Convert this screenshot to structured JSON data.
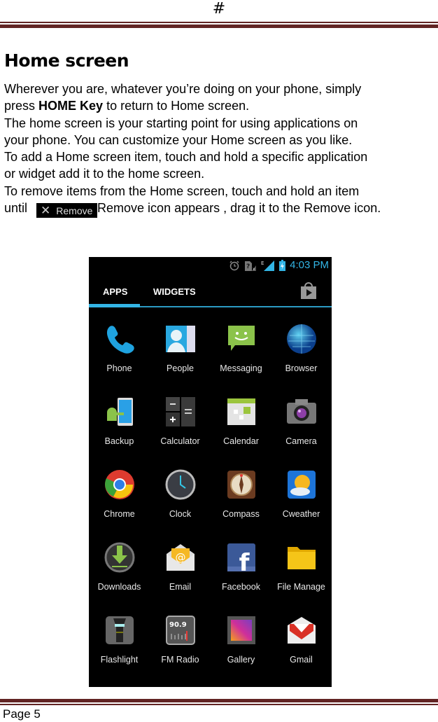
{
  "header": {
    "mark": "#"
  },
  "section": {
    "title": "Home screen",
    "paragraphs": [
      {
        "pre": "Wherever you are, whatever you’re doing on your phone, simply"
      },
      {
        "pre": "press ",
        "bold": "HOME Key",
        "post": " to return to Home screen."
      },
      {
        "pre": "The home screen is your starting point for using applications on"
      },
      {
        "pre": "your phone. You can customize your Home screen as you like."
      },
      {
        "pre": "To add a Home screen item, touch and hold a specific application"
      },
      {
        "pre": "or widget add it to the home screen."
      },
      {
        "pre": "To remove items from the Home screen, touch and hold an item"
      },
      {
        "pre": "until ",
        "chip": "Remove",
        "post": "Remove icon appears , drag it to the Remove icon."
      }
    ],
    "remove_chip": {
      "x": "✕",
      "label": "Remove"
    }
  },
  "phone": {
    "status": {
      "time": "4:03 PM",
      "icons": [
        "alarm-icon",
        "no-sim-icon",
        "signal-edge-icon",
        "battery-charging-icon"
      ],
      "edge_label": "E"
    },
    "tabs": [
      {
        "label": "APPS",
        "active": true
      },
      {
        "label": "WIDGETS",
        "active": false
      }
    ],
    "store_icon": "play-store-icon",
    "apps": [
      {
        "label": "Phone",
        "icon": "phone-icon"
      },
      {
        "label": "People",
        "icon": "people-icon"
      },
      {
        "label": "Messaging",
        "icon": "messaging-icon"
      },
      {
        "label": "Browser",
        "icon": "browser-icon"
      },
      {
        "label": "Backup",
        "icon": "backup-icon"
      },
      {
        "label": "Calculator",
        "icon": "calculator-icon"
      },
      {
        "label": "Calendar",
        "icon": "calendar-icon"
      },
      {
        "label": "Camera",
        "icon": "camera-icon"
      },
      {
        "label": "Chrome",
        "icon": "chrome-icon"
      },
      {
        "label": "Clock",
        "icon": "clock-icon"
      },
      {
        "label": "Compass",
        "icon": "compass-icon"
      },
      {
        "label": "Cweather",
        "icon": "weather-icon"
      },
      {
        "label": "Downloads",
        "icon": "downloads-icon"
      },
      {
        "label": "Email",
        "icon": "email-icon"
      },
      {
        "label": "Facebook",
        "icon": "facebook-icon"
      },
      {
        "label": "File Manage",
        "icon": "folder-icon"
      },
      {
        "label": "Flashlight",
        "icon": "flashlight-icon"
      },
      {
        "label": "FM Radio",
        "icon": "radio-icon"
      },
      {
        "label": "Gallery",
        "icon": "gallery-icon"
      },
      {
        "label": "Gmail",
        "icon": "gmail-icon"
      }
    ],
    "radio_freq": "90.9",
    "facebook_glyph": "f",
    "email_glyph": "@"
  },
  "colors": {
    "rule": "#622423",
    "accent": "#33b5e5"
  },
  "footer": {
    "page_label": "Page 5"
  }
}
